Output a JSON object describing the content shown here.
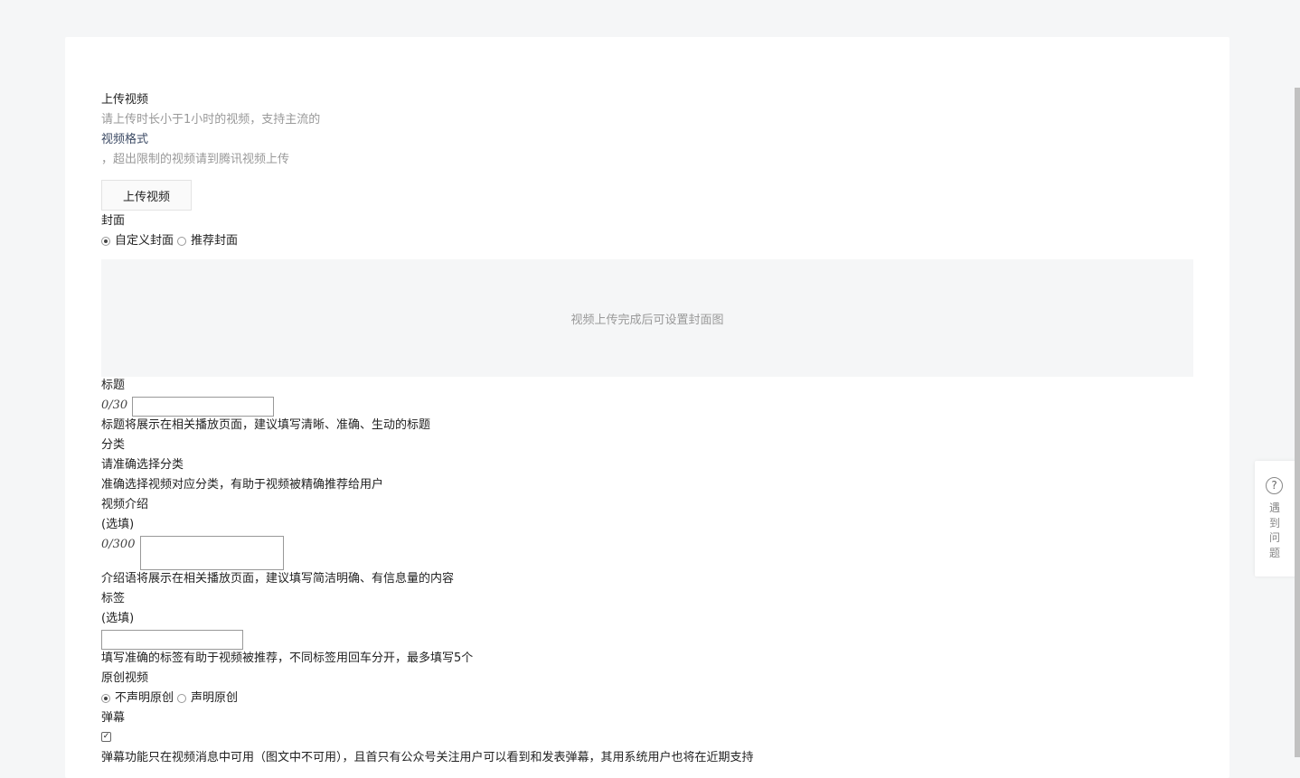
{
  "upload": {
    "label": "上传视频",
    "hint_prefix": "请上传时长小于1小时的视频，支持主流的",
    "hint_link": "视频格式",
    "hint_suffix": "，超出限制的视频请到腾讯视频上传",
    "button_label": "上传视频"
  },
  "cover": {
    "label": "封面",
    "options": [
      "自定义封面",
      "推荐封面"
    ],
    "selected": "自定义封面",
    "placeholder": "视频上传完成后可设置封面图"
  },
  "title_field": {
    "label": "标题",
    "counter": "0/30",
    "value": "",
    "hint": "标题将展示在相关播放页面，建议填写清晰、准确、生动的标题"
  },
  "category": {
    "label": "分类",
    "value": "请准确选择分类",
    "hint": "准确选择视频对应分类，有助于视频被精确推荐给用户"
  },
  "intro": {
    "label": "视频介绍",
    "optional": "(选填)",
    "counter": "0/300",
    "value": "",
    "hint": "介绍语将展示在相关播放页面，建议填写简洁明确、有信息量的内容"
  },
  "tags": {
    "label": "标签",
    "optional": "(选填)",
    "value": "",
    "hint": "填写准确的标签有助于视频被推荐，不同标签用回车分开，最多填写5个"
  },
  "original": {
    "label": "原创视频",
    "options": [
      "不声明原创",
      "声明原创"
    ],
    "selected": "不声明原创"
  },
  "danmaku": {
    "label": "弹幕",
    "checked": true,
    "hint": "弹幕功能只在视频消息中可用（图文中不可用），且首只有公众号关注用户可以看到和发表弹幕，其用系统用户也将在近期支持"
  },
  "help": {
    "icon": "question-circle-icon",
    "label": "遇到问题"
  }
}
